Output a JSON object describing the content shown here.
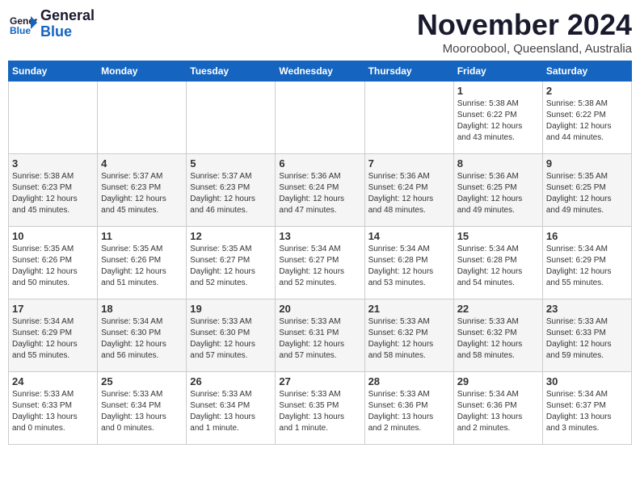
{
  "logo": {
    "general": "General",
    "blue": "Blue"
  },
  "header": {
    "month": "November 2024",
    "location": "Mooroobool, Queensland, Australia"
  },
  "days_of_week": [
    "Sunday",
    "Monday",
    "Tuesday",
    "Wednesday",
    "Thursday",
    "Friday",
    "Saturday"
  ],
  "weeks": [
    [
      {
        "day": "",
        "content": ""
      },
      {
        "day": "",
        "content": ""
      },
      {
        "day": "",
        "content": ""
      },
      {
        "day": "",
        "content": ""
      },
      {
        "day": "",
        "content": ""
      },
      {
        "day": "1",
        "content": "Sunrise: 5:38 AM\nSunset: 6:22 PM\nDaylight: 12 hours\nand 43 minutes."
      },
      {
        "day": "2",
        "content": "Sunrise: 5:38 AM\nSunset: 6:22 PM\nDaylight: 12 hours\nand 44 minutes."
      }
    ],
    [
      {
        "day": "3",
        "content": "Sunrise: 5:38 AM\nSunset: 6:23 PM\nDaylight: 12 hours\nand 45 minutes."
      },
      {
        "day": "4",
        "content": "Sunrise: 5:37 AM\nSunset: 6:23 PM\nDaylight: 12 hours\nand 45 minutes."
      },
      {
        "day": "5",
        "content": "Sunrise: 5:37 AM\nSunset: 6:23 PM\nDaylight: 12 hours\nand 46 minutes."
      },
      {
        "day": "6",
        "content": "Sunrise: 5:36 AM\nSunset: 6:24 PM\nDaylight: 12 hours\nand 47 minutes."
      },
      {
        "day": "7",
        "content": "Sunrise: 5:36 AM\nSunset: 6:24 PM\nDaylight: 12 hours\nand 48 minutes."
      },
      {
        "day": "8",
        "content": "Sunrise: 5:36 AM\nSunset: 6:25 PM\nDaylight: 12 hours\nand 49 minutes."
      },
      {
        "day": "9",
        "content": "Sunrise: 5:35 AM\nSunset: 6:25 PM\nDaylight: 12 hours\nand 49 minutes."
      }
    ],
    [
      {
        "day": "10",
        "content": "Sunrise: 5:35 AM\nSunset: 6:26 PM\nDaylight: 12 hours\nand 50 minutes."
      },
      {
        "day": "11",
        "content": "Sunrise: 5:35 AM\nSunset: 6:26 PM\nDaylight: 12 hours\nand 51 minutes."
      },
      {
        "day": "12",
        "content": "Sunrise: 5:35 AM\nSunset: 6:27 PM\nDaylight: 12 hours\nand 52 minutes."
      },
      {
        "day": "13",
        "content": "Sunrise: 5:34 AM\nSunset: 6:27 PM\nDaylight: 12 hours\nand 52 minutes."
      },
      {
        "day": "14",
        "content": "Sunrise: 5:34 AM\nSunset: 6:28 PM\nDaylight: 12 hours\nand 53 minutes."
      },
      {
        "day": "15",
        "content": "Sunrise: 5:34 AM\nSunset: 6:28 PM\nDaylight: 12 hours\nand 54 minutes."
      },
      {
        "day": "16",
        "content": "Sunrise: 5:34 AM\nSunset: 6:29 PM\nDaylight: 12 hours\nand 55 minutes."
      }
    ],
    [
      {
        "day": "17",
        "content": "Sunrise: 5:34 AM\nSunset: 6:29 PM\nDaylight: 12 hours\nand 55 minutes."
      },
      {
        "day": "18",
        "content": "Sunrise: 5:34 AM\nSunset: 6:30 PM\nDaylight: 12 hours\nand 56 minutes."
      },
      {
        "day": "19",
        "content": "Sunrise: 5:33 AM\nSunset: 6:30 PM\nDaylight: 12 hours\nand 57 minutes."
      },
      {
        "day": "20",
        "content": "Sunrise: 5:33 AM\nSunset: 6:31 PM\nDaylight: 12 hours\nand 57 minutes."
      },
      {
        "day": "21",
        "content": "Sunrise: 5:33 AM\nSunset: 6:32 PM\nDaylight: 12 hours\nand 58 minutes."
      },
      {
        "day": "22",
        "content": "Sunrise: 5:33 AM\nSunset: 6:32 PM\nDaylight: 12 hours\nand 58 minutes."
      },
      {
        "day": "23",
        "content": "Sunrise: 5:33 AM\nSunset: 6:33 PM\nDaylight: 12 hours\nand 59 minutes."
      }
    ],
    [
      {
        "day": "24",
        "content": "Sunrise: 5:33 AM\nSunset: 6:33 PM\nDaylight: 13 hours\nand 0 minutes."
      },
      {
        "day": "25",
        "content": "Sunrise: 5:33 AM\nSunset: 6:34 PM\nDaylight: 13 hours\nand 0 minutes."
      },
      {
        "day": "26",
        "content": "Sunrise: 5:33 AM\nSunset: 6:34 PM\nDaylight: 13 hours\nand 1 minute."
      },
      {
        "day": "27",
        "content": "Sunrise: 5:33 AM\nSunset: 6:35 PM\nDaylight: 13 hours\nand 1 minute."
      },
      {
        "day": "28",
        "content": "Sunrise: 5:33 AM\nSunset: 6:36 PM\nDaylight: 13 hours\nand 2 minutes."
      },
      {
        "day": "29",
        "content": "Sunrise: 5:34 AM\nSunset: 6:36 PM\nDaylight: 13 hours\nand 2 minutes."
      },
      {
        "day": "30",
        "content": "Sunrise: 5:34 AM\nSunset: 6:37 PM\nDaylight: 13 hours\nand 3 minutes."
      }
    ]
  ]
}
